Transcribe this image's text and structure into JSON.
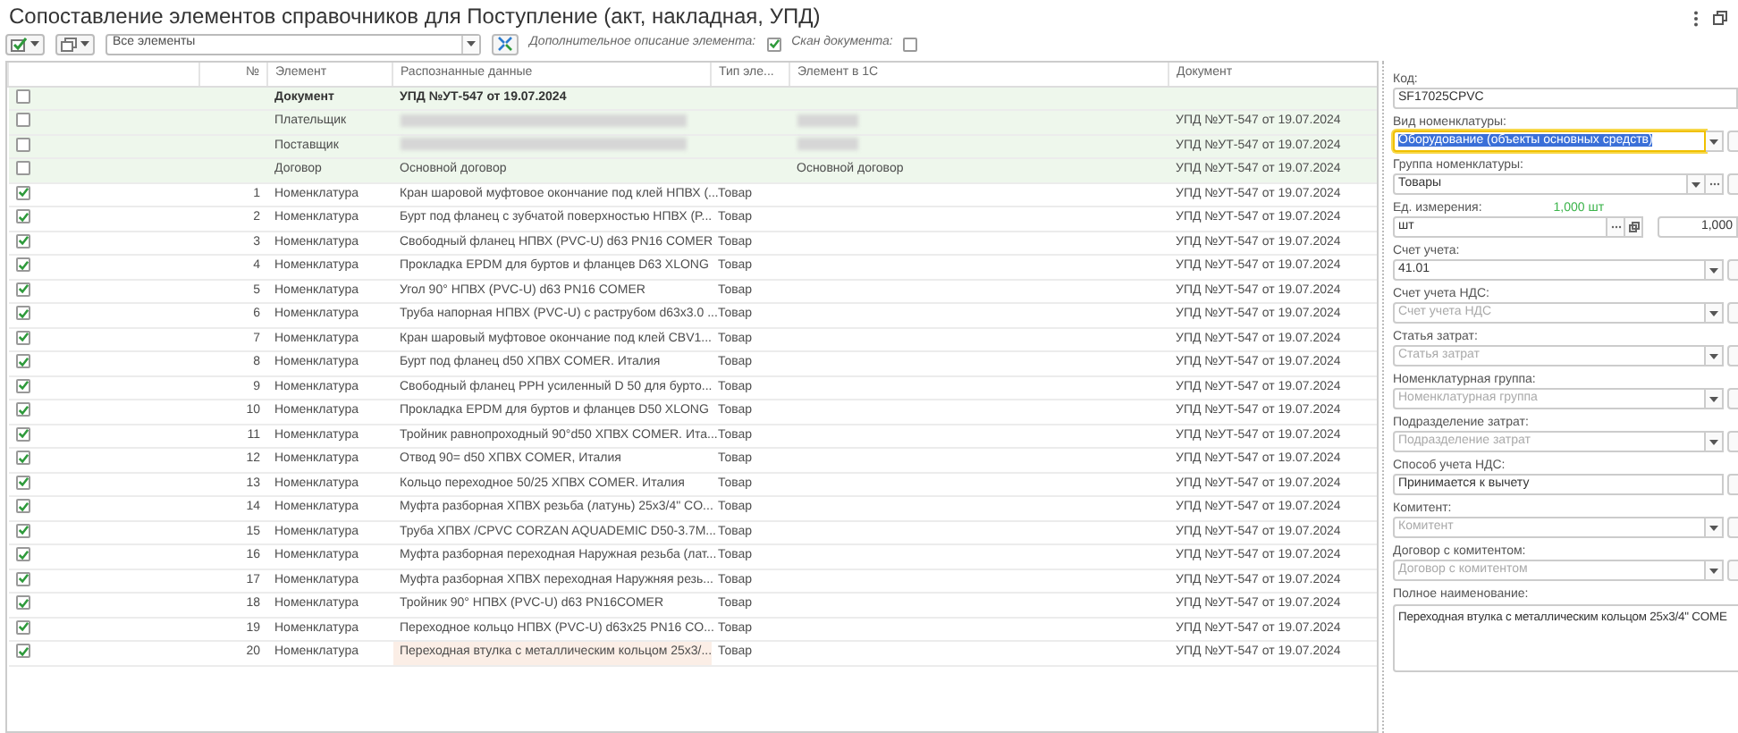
{
  "window": {
    "title": "Сопоставление элементов справочников для Поступление (акт, накладная, УПД)"
  },
  "toolbar": {
    "filter": "Все элементы",
    "options": [
      {
        "label": "Дополнительное описание элемента:",
        "checked": true
      },
      {
        "label": "Скан документа:",
        "checked": false
      }
    ]
  },
  "table": {
    "columns": [
      "№",
      "Элемент",
      "Распознанные данные",
      "Тип эле...",
      "Элемент в 1С",
      "Документ"
    ],
    "rows": [
      {
        "kind": "document",
        "checked": false,
        "selected": false,
        "element": "Документ",
        "recognized": "УПД №УТ-547 от 19.07.2024"
      },
      {
        "kind": "attribute",
        "checked": false,
        "selected": false,
        "element": "Плательщик",
        "recognized_hidden": true,
        "element_1c_hidden": true,
        "document": "УПД №УТ-547 от 19.07.2024"
      },
      {
        "kind": "attribute",
        "checked": false,
        "selected": false,
        "element": "Поставщик",
        "recognized_hidden": true,
        "element_1c_hidden": true,
        "document": "УПД №УТ-547 от 19.07.2024"
      },
      {
        "kind": "attribute",
        "checked": false,
        "selected": false,
        "element": "Договор",
        "recognized": "Основной договор",
        "element_1c": "Основной договор",
        "document": "УПД №УТ-547 от 19.07.2024"
      },
      {
        "kind": "item",
        "checked": true,
        "selected": false,
        "number": "1",
        "element": "Номенклатура",
        "recognized": "Кран шаровой муфтовое окончание под клей НПВХ (...",
        "type": "Товар",
        "document": "УПД №УТ-547 от 19.07.2024"
      },
      {
        "kind": "item",
        "checked": true,
        "selected": false,
        "number": "2",
        "element": "Номенклатура",
        "recognized": "Бурт под фланец с зубчатой поверхностью НПВХ (P...",
        "type": "Товар",
        "document": "УПД №УТ-547 от 19.07.2024"
      },
      {
        "kind": "item",
        "checked": true,
        "selected": false,
        "number": "3",
        "element": "Номенклатура",
        "recognized": "Свободный фланец НПВХ (PVC-U) d63 PN16 COMER",
        "type": "Товар",
        "document": "УПД №УТ-547 от 19.07.2024"
      },
      {
        "kind": "item",
        "checked": true,
        "selected": false,
        "number": "4",
        "element": "Номенклатура",
        "recognized": "Прокладка EPDM для буртов и фланцев D63 XLONG",
        "type": "Товар",
        "document": "УПД №УТ-547 от 19.07.2024"
      },
      {
        "kind": "item",
        "checked": true,
        "selected": false,
        "number": "5",
        "element": "Номенклатура",
        "recognized": "Угол 90° НПВХ (PVC-U) d63 PN16 COMER",
        "type": "Товар",
        "document": "УПД №УТ-547 от 19.07.2024"
      },
      {
        "kind": "item",
        "checked": true,
        "selected": false,
        "number": "6",
        "element": "Номенклатура",
        "recognized": "Труба напорная НПВХ (PVC-U) с раструбом d63x3.0 ...",
        "type": "Товар",
        "document": "УПД №УТ-547 от 19.07.2024"
      },
      {
        "kind": "item",
        "checked": true,
        "selected": false,
        "number": "7",
        "element": "Номенклатура",
        "recognized": "Кран шаровый муфтовое окончание под клей CBV1...",
        "type": "Товар",
        "document": "УПД №УТ-547 от 19.07.2024"
      },
      {
        "kind": "item",
        "checked": true,
        "selected": false,
        "number": "8",
        "element": "Номенклатура",
        "recognized": "Бурт под фланец d50 ХПВХ COMER. Италия",
        "type": "Товар",
        "document": "УПД №УТ-547 от 19.07.2024"
      },
      {
        "kind": "item",
        "checked": true,
        "selected": false,
        "number": "9",
        "element": "Номенклатура",
        "recognized": "Свободный фланец PPH усиленный D 50 для бурто...",
        "type": "Товар",
        "document": "УПД №УТ-547 от 19.07.2024"
      },
      {
        "kind": "item",
        "checked": true,
        "selected": false,
        "number": "10",
        "element": "Номенклатура",
        "recognized": "Прокладка EPDM для буртов и фланцев D50 XLONG",
        "type": "Товар",
        "document": "УПД №УТ-547 от 19.07.2024"
      },
      {
        "kind": "item",
        "checked": true,
        "selected": false,
        "number": "11",
        "element": "Номенклатура",
        "recognized": "Тройник равнопроходный 90°d50 ХПВХ COMER. Ита...",
        "type": "Товар",
        "document": "УПД №УТ-547 от 19.07.2024"
      },
      {
        "kind": "item",
        "checked": true,
        "selected": false,
        "number": "12",
        "element": "Номенклатура",
        "recognized": "Отвод 90= d50 ХПВХ COMER, Италия",
        "type": "Товар",
        "document": "УПД №УТ-547 от 19.07.2024"
      },
      {
        "kind": "item",
        "checked": true,
        "selected": false,
        "number": "13",
        "element": "Номенклатура",
        "recognized": "Кольцо переходное 50/25 ХПВХ COMER. Италия",
        "type": "Товар",
        "document": "УПД №УТ-547 от 19.07.2024"
      },
      {
        "kind": "item",
        "checked": true,
        "selected": false,
        "number": "14",
        "element": "Номенклатура",
        "recognized": "Муфта разборная ХПВХ резьба (латунь) 25x3/4\" CO...",
        "type": "Товар",
        "document": "УПД №УТ-547 от 19.07.2024"
      },
      {
        "kind": "item",
        "checked": true,
        "selected": false,
        "number": "15",
        "element": "Номенклатура",
        "recognized": "Труба ХПВХ /CPVC CORZAN AQUADEMIC D50-3.7M...",
        "type": "Товар",
        "document": "УПД №УТ-547 от 19.07.2024"
      },
      {
        "kind": "item",
        "checked": true,
        "selected": false,
        "number": "16",
        "element": "Номенклатура",
        "recognized": "Муфта разборная переходная Наружная резьба (лат...",
        "type": "Товар",
        "document": "УПД №УТ-547 от 19.07.2024"
      },
      {
        "kind": "item",
        "checked": true,
        "selected": false,
        "number": "17",
        "element": "Номенклатура",
        "recognized": "Муфта разборная ХПВХ переходная Наружняя резь...",
        "type": "Товар",
        "document": "УПД №УТ-547 от 19.07.2024"
      },
      {
        "kind": "item",
        "checked": true,
        "selected": false,
        "number": "18",
        "element": "Номенклатура",
        "recognized": "Тройник 90° НПВХ (PVC-U) d63 PN16COMER",
        "type": "Товар",
        "document": "УПД №УТ-547 от 19.07.2024"
      },
      {
        "kind": "item",
        "checked": true,
        "selected": false,
        "number": "19",
        "element": "Номенклатура",
        "recognized": "Переходное кольцо НПВХ (PVC-U) d63x25 PN16 CO...",
        "type": "Товар",
        "document": "УПД №УТ-547 от 19.07.2024"
      },
      {
        "kind": "item",
        "checked": true,
        "selected": true,
        "number": "20",
        "element": "Номенклатура",
        "recognized": "Переходная втулка с металлическим кольцом 25x3/...",
        "type": "Товар",
        "document": "УПД №УТ-547 от 19.07.2024"
      }
    ]
  },
  "details": [
    {
      "kind": "text",
      "label": "Код:",
      "value": "SF17025CPVC",
      "focused": false
    },
    {
      "kind": "select",
      "label": "Вид номенклатуры:",
      "value": "Оборудование (объекты основных средств)",
      "focused": true
    },
    {
      "kind": "select-pick",
      "label": "Группа номенклатуры:",
      "value": "Товары",
      "focused": false
    },
    {
      "kind": "unit",
      "label": "Ед. измерения:",
      "hint": "1,000  шт",
      "value": "шт",
      "factor": "1,000",
      "focused": false
    },
    {
      "kind": "select",
      "label": "Счет учета:",
      "value": "41.01",
      "focused": false
    },
    {
      "kind": "select",
      "label": "Счет учета НДС:",
      "placeholder": "Счет учета НДС",
      "focused": false
    },
    {
      "kind": "select",
      "label": "Статья затрат:",
      "placeholder": "Статья затрат",
      "focused": false
    },
    {
      "kind": "select",
      "label": "Номенклатурная группа:",
      "placeholder": "Номенклатурная группа",
      "focused": false
    },
    {
      "kind": "select",
      "label": "Подразделение затрат:",
      "placeholder": "Подразделение затрат",
      "focused": false
    },
    {
      "kind": "button-field",
      "label": "Способ учета НДС:",
      "value": "Принимается к вычету",
      "focused": false
    },
    {
      "kind": "select",
      "label": "Комитент:",
      "placeholder": "Комитент",
      "focused": false
    },
    {
      "kind": "select",
      "label": "Договор с комитентом:",
      "placeholder": "Договор с комитентом",
      "focused": false
    },
    {
      "kind": "memo",
      "label": "Полное наименование:",
      "value": "Переходная втулка с металлическим кольцом 25x3/4\" COME",
      "focused": false
    }
  ]
}
